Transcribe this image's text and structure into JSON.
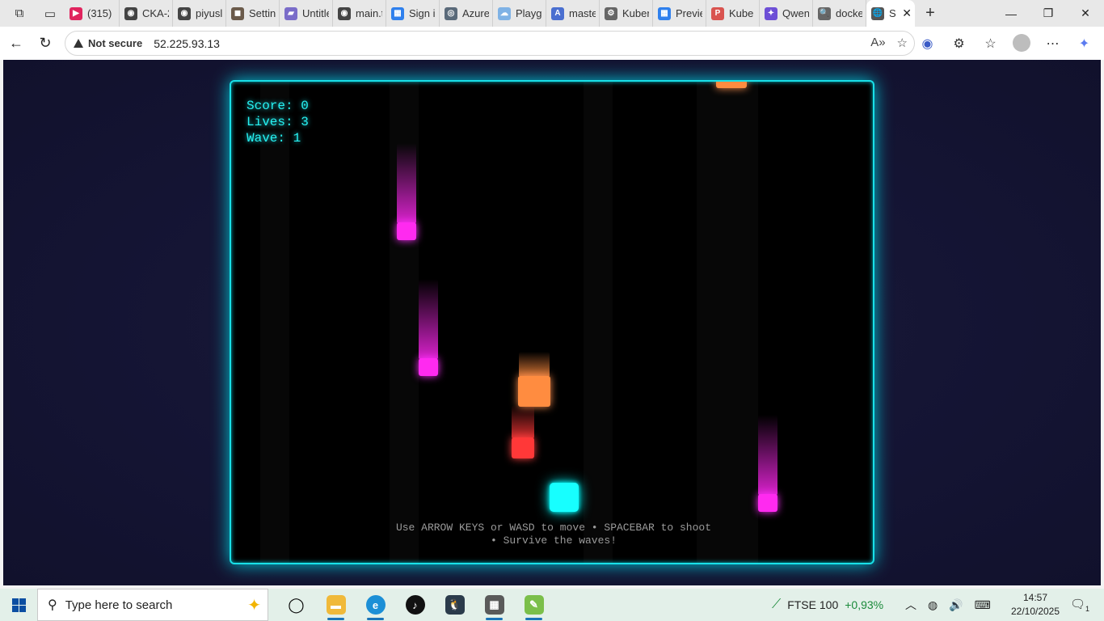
{
  "browser": {
    "tabs": [
      {
        "title": "(315) |",
        "color": "#e0245e",
        "glyph": "▶"
      },
      {
        "title": "CKA-2",
        "color": "#444444",
        "glyph": "◉"
      },
      {
        "title": "piyusl",
        "color": "#444444",
        "glyph": "◉"
      },
      {
        "title": "Settin",
        "color": "#6b5b4b",
        "glyph": "◼"
      },
      {
        "title": "Untitle",
        "color": "#7a6cc9",
        "glyph": "▰"
      },
      {
        "title": "main.t",
        "color": "#444444",
        "glyph": "◉"
      },
      {
        "title": "Sign i",
        "color": "#2f80ed",
        "glyph": "▦"
      },
      {
        "title": "Azure",
        "color": "#5a6a7a",
        "glyph": "◎"
      },
      {
        "title": "Playgr",
        "color": "#7fb2e5",
        "glyph": "☁"
      },
      {
        "title": "maste",
        "color": "#4a6fd0",
        "glyph": "A"
      },
      {
        "title": "Kuber",
        "color": "#666666",
        "glyph": "⚙"
      },
      {
        "title": "Previe",
        "color": "#2f80ed",
        "glyph": "▦"
      },
      {
        "title": "Kube",
        "color": "#d9534f",
        "glyph": "P"
      },
      {
        "title": "Qwen",
        "color": "#6d4fd6",
        "glyph": "✦"
      },
      {
        "title": "docke",
        "color": "#666666",
        "glyph": "🔍"
      },
      {
        "title": "S",
        "color": "#555555",
        "glyph": "🌐"
      }
    ],
    "security_label": "Not secure",
    "url": "52.225.93.13"
  },
  "game": {
    "hud": {
      "score_label": "Score:",
      "score_value": "0",
      "lives_label": "Lives:",
      "lives_value": "3",
      "wave_label": "Wave:",
      "wave_value": "1"
    },
    "instructions": "Use ARROW KEYS or WASD to move • SPACEBAR to shoot • Survive the waves!",
    "colors": {
      "border": "#19e0e8",
      "player": "#17ffff",
      "enemy_magenta": "#ff2af0",
      "enemy_orange": "#ff8c40",
      "enemy_red": "#ff3838",
      "hud_text": "#27f2f2"
    }
  },
  "taskbar": {
    "search_placeholder": "Type here to search",
    "ticker_name": "FTSE 100",
    "ticker_change": "+0,93%",
    "time": "14:57",
    "date": "22/10/2025",
    "notification_count": "1"
  }
}
